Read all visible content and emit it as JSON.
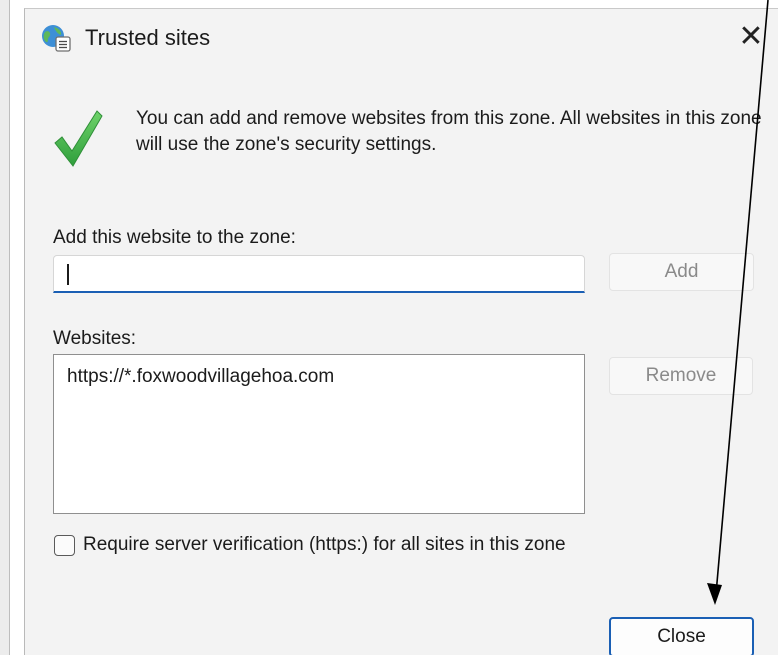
{
  "dialog": {
    "title": "Trusted sites",
    "close_glyph": "✕",
    "icon": "globe-icon",
    "info_icon": "checkmark-icon",
    "info_text": "You can add and remove websites from this zone. All websites in this zone will use the zone's security settings.",
    "add_label": "Add this website to the zone:",
    "add_input": {
      "value": "",
      "placeholder": ""
    },
    "add_button": "Add",
    "websites_label": "Websites:",
    "websites": [
      "https://*.foxwoodvillagehoa.com"
    ],
    "remove_button": "Remove",
    "require_verification": {
      "label": "Require server verification (https:) for all sites in this zone",
      "checked": false
    },
    "close_button": "Close"
  },
  "colors": {
    "accent": "#1a5fb4",
    "dialog_bg": "#f3f3f3",
    "check_green": "#39b54a",
    "arrow": "#000000"
  }
}
